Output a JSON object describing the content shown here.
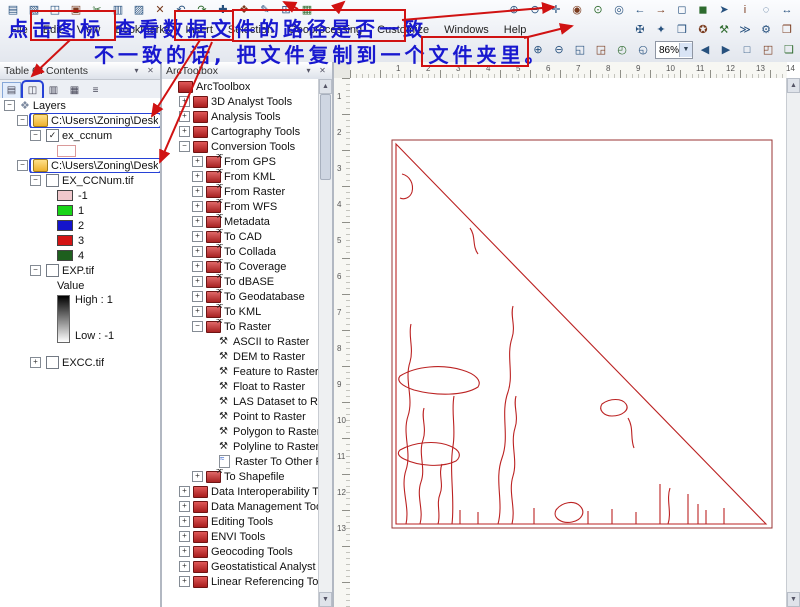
{
  "menu": {
    "items": [
      "File",
      "Edit",
      "View",
      "Bookmarks",
      "Insert",
      "Selection",
      "Geoprocessing",
      "Customize",
      "Windows",
      "Help"
    ]
  },
  "toolbars": {
    "row1_left": [
      "new",
      "open",
      "save",
      "print",
      "cut",
      "copy",
      "paste",
      "delete",
      "undo",
      "redo",
      "add-data",
      "add-basemap",
      "editor",
      "snapping",
      "attributes"
    ],
    "row1_right": [
      "zoom-in",
      "zoom-out",
      "pan",
      "full-extent",
      "fixed-zoom-in",
      "fixed-zoom-out",
      "go-back",
      "go-forward",
      "select-features",
      "clear-selection",
      "select-elements",
      "identify",
      "find",
      "measure"
    ],
    "menu_right": [
      "georeferencing",
      "image-analysis",
      "catalog-window",
      "search-window",
      "arctoolbox-window",
      "python-window",
      "model-builder",
      "viewer-window"
    ],
    "row3_left": [
      "layout-zoom-in",
      "layout-zoom-out",
      "layout-zoom-whole-page",
      "layout-zoom-100",
      "layout-fixed-zoom-in",
      "layout-fixed-zoom-out"
    ],
    "scale_value": "86%",
    "row3_right": [
      "layout-go-back",
      "layout-go-forward",
      "toggle-draft-mode",
      "focus-data-frame",
      "data-driven-pages"
    ]
  },
  "annotation": {
    "line1": "点击图标 查看数据文件的路径是否一致",
    "line2": "不一致的话, 把文件复制到一个文件夹里。"
  },
  "toc": {
    "title": "Table Of Contents",
    "header_icons": [
      {
        "name": "auto-hide-pin-icon"
      },
      {
        "name": "close-icon"
      }
    ],
    "toolbar_icons": [
      {
        "name": "list-by-drawing-order",
        "pressed": true
      },
      {
        "name": "list-by-source",
        "annotated": true
      },
      {
        "name": "list-by-visibility"
      },
      {
        "name": "list-by-selection"
      },
      {
        "name": "toc-options"
      }
    ],
    "rows": [
      {
        "t": "group",
        "label": "Layers",
        "indent": 0,
        "exp": "-"
      },
      {
        "t": "frame",
        "label": "C:\\Users\\Zoning\\Desktop",
        "indent": 1,
        "exp": "-",
        "boxed": true
      },
      {
        "t": "layer",
        "label": "ex_ccnum",
        "indent": 2,
        "exp": "-",
        "check": true,
        "checked": true
      },
      {
        "t": "patch",
        "indent": 3,
        "outline": "#da9a9a",
        "fill": "#ffffff"
      },
      {
        "t": "frame",
        "label": "C:\\Users\\Zoning\\Desktop",
        "indent": 1,
        "exp": "-",
        "boxed": true
      },
      {
        "t": "layer",
        "label": "EX_CCNum.tif",
        "indent": 2,
        "exp": "-",
        "check": true,
        "checked": false
      },
      {
        "t": "chip",
        "label": "-1",
        "color": "#f0c8cc",
        "indent": 3
      },
      {
        "t": "chip",
        "label": "1",
        "color": "#17d417",
        "indent": 3
      },
      {
        "t": "chip",
        "label": "2",
        "color": "#1414cc",
        "indent": 3
      },
      {
        "t": "chip",
        "label": "3",
        "color": "#d41414",
        "indent": 3
      },
      {
        "t": "chip",
        "label": "4",
        "color": "#1e5f1e",
        "indent": 3
      },
      {
        "t": "layer",
        "label": "EXP.tif",
        "indent": 2,
        "exp": "-",
        "check": true,
        "checked": false
      },
      {
        "t": "text",
        "label": "Value",
        "indent": 3
      },
      {
        "t": "ramp",
        "high": "High : 1",
        "low": "Low : -1",
        "indent": 3
      },
      {
        "t": "spacer",
        "h": 12
      },
      {
        "t": "layer",
        "label": "EXCC.tif",
        "indent": 2,
        "exp": "+",
        "check": true,
        "checked": false
      }
    ]
  },
  "toolbox": {
    "title": "ArcToolbox",
    "header_icons": [
      {
        "name": "auto-hide-pin-icon"
      },
      {
        "name": "close-icon"
      }
    ],
    "rows": [
      {
        "label": "ArcToolbox",
        "icon": "root",
        "indent": 0
      },
      {
        "label": "3D Analyst Tools",
        "icon": "toolbox",
        "exp": "+",
        "indent": 1
      },
      {
        "label": "Analysis Tools",
        "icon": "toolbox",
        "exp": "+",
        "indent": 1
      },
      {
        "label": "Cartography Tools",
        "icon": "toolbox",
        "exp": "+",
        "indent": 1
      },
      {
        "label": "Conversion Tools",
        "icon": "toolbox",
        "exp": "-",
        "indent": 1
      },
      {
        "label": "From GPS",
        "icon": "toolset",
        "exp": "+",
        "indent": 2
      },
      {
        "label": "From KML",
        "icon": "toolset",
        "exp": "+",
        "indent": 2
      },
      {
        "label": "From Raster",
        "icon": "toolset",
        "exp": "+",
        "indent": 2
      },
      {
        "label": "From WFS",
        "icon": "toolset",
        "exp": "+",
        "indent": 2
      },
      {
        "label": "Metadata",
        "icon": "toolset",
        "exp": "+",
        "indent": 2
      },
      {
        "label": "To CAD",
        "icon": "toolset",
        "exp": "+",
        "indent": 2
      },
      {
        "label": "To Collada",
        "icon": "toolset",
        "exp": "+",
        "indent": 2
      },
      {
        "label": "To Coverage",
        "icon": "toolset",
        "exp": "+",
        "indent": 2
      },
      {
        "label": "To dBASE",
        "icon": "toolset",
        "exp": "+",
        "indent": 2
      },
      {
        "label": "To Geodatabase",
        "icon": "toolset",
        "exp": "+",
        "indent": 2
      },
      {
        "label": "To KML",
        "icon": "toolset",
        "exp": "+",
        "indent": 2
      },
      {
        "label": "To Raster",
        "icon": "toolset",
        "exp": "-",
        "indent": 2
      },
      {
        "label": "ASCII to Raster",
        "icon": "tool",
        "indent": 3
      },
      {
        "label": "DEM to Raster",
        "icon": "tool",
        "indent": 3
      },
      {
        "label": "Feature to Raster",
        "icon": "tool",
        "indent": 3
      },
      {
        "label": "Float to Raster",
        "icon": "tool",
        "indent": 3
      },
      {
        "label": "LAS Dataset to Raster",
        "icon": "tool",
        "indent": 3
      },
      {
        "label": "Point to Raster",
        "icon": "tool",
        "indent": 3
      },
      {
        "label": "Polygon to Raster",
        "icon": "tool",
        "indent": 3
      },
      {
        "label": "Polyline to Raster",
        "icon": "tool",
        "indent": 3
      },
      {
        "label": "Raster To Other Format",
        "icon": "script",
        "indent": 3
      },
      {
        "label": "To Shapefile",
        "icon": "toolset",
        "exp": "+",
        "indent": 2
      },
      {
        "label": "Data Interoperability Tools",
        "icon": "toolbox",
        "exp": "+",
        "indent": 1
      },
      {
        "label": "Data Management Tools",
        "icon": "toolbox",
        "exp": "+",
        "indent": 1
      },
      {
        "label": "Editing Tools",
        "icon": "toolbox",
        "exp": "+",
        "indent": 1
      },
      {
        "label": "ENVI Tools",
        "icon": "toolbox",
        "exp": "+",
        "indent": 1
      },
      {
        "label": "Geocoding Tools",
        "icon": "toolbox",
        "exp": "+",
        "indent": 1
      },
      {
        "label": "Geostatistical Analyst Tools",
        "icon": "toolbox",
        "exp": "+",
        "indent": 1
      },
      {
        "label": "Linear Referencing Tools",
        "icon": "toolbox",
        "exp": "+",
        "indent": 1
      }
    ]
  },
  "map": {
    "ruler_top": [
      "1",
      "2",
      "3",
      "4",
      "5",
      "6",
      "7",
      "8",
      "9",
      "10",
      "11",
      "12",
      "13",
      "14"
    ],
    "ruler_left": [
      "1",
      "2",
      "3",
      "4",
      "5",
      "6",
      "7",
      "8",
      "9",
      "10",
      "11",
      "12",
      "13"
    ]
  }
}
